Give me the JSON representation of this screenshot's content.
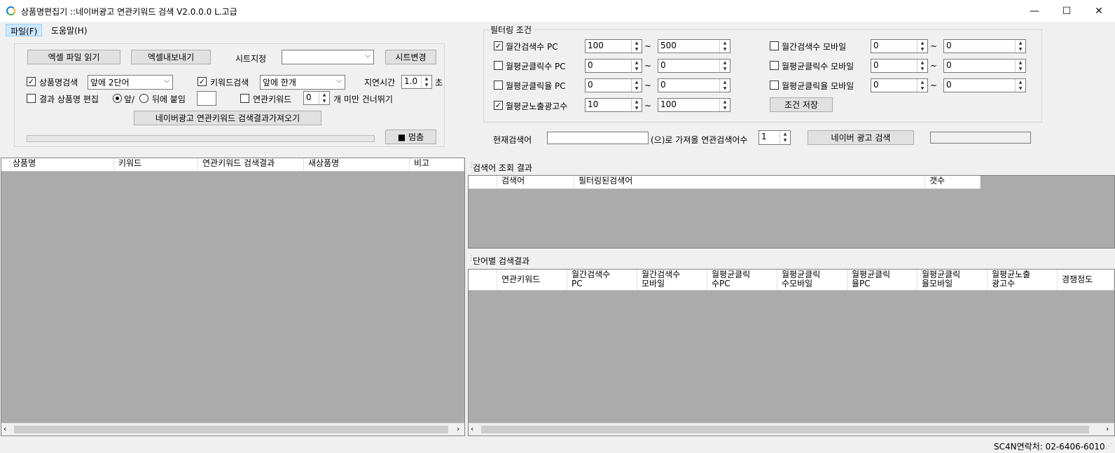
{
  "window": {
    "title": "상품명편집기 ::네이버광고 연관키워드 검색 V2.0.0.0 L.고급",
    "minimize_glyph": "—",
    "maximize_glyph": "☐",
    "close_glyph": "✕"
  },
  "menu": {
    "items": [
      "파일(F)",
      "도움말(H)"
    ]
  },
  "toolbar": {
    "excel_read": "엑셀 파일 읽기",
    "excel_export": "엑셀내보내기",
    "sheet_label": "시트지정",
    "sheet_value": "",
    "sheet_change": "시트변경",
    "product_search_label": "상품명검색",
    "product_search_checked": true,
    "product_search_option": "앞에 2단어",
    "keyword_search_label": "키워드검색",
    "keyword_search_checked": true,
    "keyword_search_option": "앞에 한개",
    "delay_label": "지연시간",
    "delay_value": "1.0",
    "delay_unit": "초",
    "edit_result_label": "결과 상품명 편집",
    "edit_result_checked": false,
    "radio_front": "앞/",
    "radio_back": "뒤에 붙임",
    "append_value": "",
    "related_keyword_label": "연관키워드",
    "related_keyword_checked": false,
    "related_keyword_count": "0",
    "skip_label": "개 미만 건너뛰기",
    "fetch_button": "네이버광고 연관키워드 검색결과가져오기",
    "progress": 0,
    "stop_button": "■ 멈춤"
  },
  "filter": {
    "title": "필터링 조건",
    "rows_left": [
      {
        "label": "월간검색수 PC",
        "checked": true,
        "min": "100",
        "max": "500"
      },
      {
        "label": "월평균클릭수 PC",
        "checked": false,
        "min": "0",
        "max": "0"
      },
      {
        "label": "월평균클릭율 PC",
        "checked": false,
        "min": "0",
        "max": "0"
      },
      {
        "label": "월평균노출광고수",
        "checked": true,
        "min": "10",
        "max": "100"
      }
    ],
    "rows_right": [
      {
        "label": "월간검색수 모바일",
        "checked": false,
        "min": "0",
        "max": "0"
      },
      {
        "label": "월평균클릭수 모바일",
        "checked": false,
        "min": "0",
        "max": "0"
      },
      {
        "label": "월평균클릭율 모바일",
        "checked": false,
        "min": "0",
        "max": "0"
      }
    ],
    "tilde": "~",
    "save_button": "조건 저장"
  },
  "search": {
    "current_label": "현재검색어",
    "current_value": "",
    "count_label": "(으)로 가져올 연관검색어수",
    "count_value": "1",
    "search_button": "네이버 광고 검색",
    "status_value": ""
  },
  "left_grid": {
    "columns": [
      "상품명",
      "키워드",
      "연관키워드 검색결과",
      "새상품명",
      "비고"
    ]
  },
  "query_result": {
    "title": "검색어 조회 결과",
    "columns": [
      "검색어",
      "필터링된검색어",
      "갯수"
    ]
  },
  "word_result": {
    "title": "단어별 검색결과",
    "columns": [
      [
        "연관키워드"
      ],
      [
        "월간검색수",
        "PC"
      ],
      [
        "월간검색수",
        "모바일"
      ],
      [
        "월평균클릭",
        "수PC"
      ],
      [
        "월평균클릭",
        "수모바일"
      ],
      [
        "월평균클릭",
        "율PC"
      ],
      [
        "월평균클릭",
        "율모바일"
      ],
      [
        "월평균노출",
        "광고수"
      ],
      [
        "경쟁정도"
      ]
    ]
  },
  "statusbar": {
    "contact": "SC4N연락처: 02-6406-6010"
  }
}
